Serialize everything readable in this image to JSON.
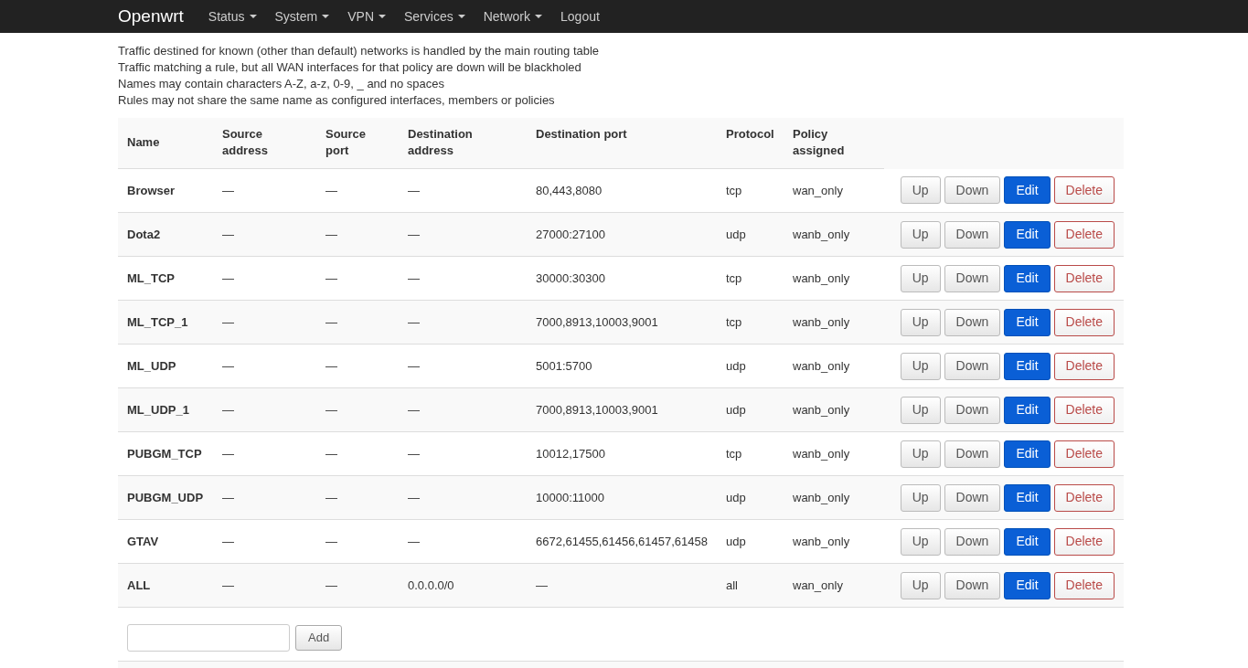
{
  "navbar": {
    "brand": "Openwrt",
    "menu": [
      {
        "label": "Status",
        "dropdown": true
      },
      {
        "label": "System",
        "dropdown": true
      },
      {
        "label": "VPN",
        "dropdown": true
      },
      {
        "label": "Services",
        "dropdown": true
      },
      {
        "label": "Network",
        "dropdown": true
      },
      {
        "label": "Logout",
        "dropdown": false
      }
    ]
  },
  "notes": [
    "Traffic destined for known (other than default) networks is handled by the main routing table",
    "Traffic matching a rule, but all WAN interfaces for that policy are down will be blackholed",
    "Names may contain characters A-Z, a-z, 0-9, _ and no spaces",
    "Rules may not share the same name as configured interfaces, members or policies"
  ],
  "table": {
    "columns": [
      "Name",
      "Source address",
      "Source port",
      "Destination address",
      "Destination port",
      "Protocol",
      "Policy assigned"
    ],
    "rows": [
      {
        "cells": [
          "Browser",
          "—",
          "—",
          "—",
          "80,443,8080",
          "tcp",
          "wan_only"
        ],
        "actions": [
          {
            "label": "Up",
            "kind": "default"
          },
          {
            "label": "Down",
            "kind": "default"
          },
          {
            "label": "Edit",
            "kind": "primary"
          },
          {
            "label": "Delete",
            "kind": "danger"
          }
        ]
      },
      {
        "cells": [
          "Dota2",
          "—",
          "—",
          "—",
          "27000:27100",
          "udp",
          "wanb_only"
        ],
        "actions": [
          {
            "label": "Up",
            "kind": "default"
          },
          {
            "label": "Down",
            "kind": "default"
          },
          {
            "label": "Edit",
            "kind": "primary"
          },
          {
            "label": "Delete",
            "kind": "danger"
          }
        ]
      },
      {
        "cells": [
          "ML_TCP",
          "—",
          "—",
          "—",
          "30000:30300",
          "tcp",
          "wanb_only"
        ],
        "actions": [
          {
            "label": "Up",
            "kind": "default"
          },
          {
            "label": "Down",
            "kind": "default"
          },
          {
            "label": "Edit",
            "kind": "primary"
          },
          {
            "label": "Delete",
            "kind": "danger"
          }
        ]
      },
      {
        "cells": [
          "ML_TCP_1",
          "—",
          "—",
          "—",
          "7000,8913,10003,9001",
          "tcp",
          "wanb_only"
        ],
        "actions": [
          {
            "label": "Up",
            "kind": "default"
          },
          {
            "label": "Down",
            "kind": "default"
          },
          {
            "label": "Edit",
            "kind": "primary"
          },
          {
            "label": "Delete",
            "kind": "danger"
          }
        ]
      },
      {
        "cells": [
          "ML_UDP",
          "—",
          "—",
          "—",
          "5001:5700",
          "udp",
          "wanb_only"
        ],
        "actions": [
          {
            "label": "Up",
            "kind": "default"
          },
          {
            "label": "Down",
            "kind": "default"
          },
          {
            "label": "Edit",
            "kind": "primary"
          },
          {
            "label": "Delete",
            "kind": "danger"
          }
        ]
      },
      {
        "cells": [
          "ML_UDP_1",
          "—",
          "—",
          "—",
          "7000,8913,10003,9001",
          "udp",
          "wanb_only"
        ],
        "actions": [
          {
            "label": "Up",
            "kind": "default"
          },
          {
            "label": "Down",
            "kind": "default"
          },
          {
            "label": "Edit",
            "kind": "primary"
          },
          {
            "label": "Delete",
            "kind": "danger"
          }
        ]
      },
      {
        "cells": [
          "PUBGM_TCP",
          "—",
          "—",
          "—",
          "10012,17500",
          "tcp",
          "wanb_only"
        ],
        "actions": [
          {
            "label": "Up",
            "kind": "default"
          },
          {
            "label": "Down",
            "kind": "default"
          },
          {
            "label": "Edit",
            "kind": "primary"
          },
          {
            "label": "Delete",
            "kind": "danger"
          }
        ]
      },
      {
        "cells": [
          "PUBGM_UDP",
          "—",
          "—",
          "—",
          "10000:11000",
          "udp",
          "wanb_only"
        ],
        "actions": [
          {
            "label": "Up",
            "kind": "default"
          },
          {
            "label": "Down",
            "kind": "default"
          },
          {
            "label": "Edit",
            "kind": "primary"
          },
          {
            "label": "Delete",
            "kind": "danger"
          }
        ]
      },
      {
        "cells": [
          "GTAV",
          "—",
          "—",
          "—",
          "6672,61455,61456,61457,61458",
          "udp",
          "wanb_only"
        ],
        "actions": [
          {
            "label": "Up",
            "kind": "default"
          },
          {
            "label": "Down",
            "kind": "default"
          },
          {
            "label": "Edit",
            "kind": "primary"
          },
          {
            "label": "Delete",
            "kind": "danger"
          }
        ]
      },
      {
        "cells": [
          "ALL",
          "—",
          "—",
          "0.0.0.0/0",
          "—",
          "all",
          "wan_only"
        ],
        "actions": [
          {
            "label": "Up",
            "kind": "default"
          },
          {
            "label": "Down",
            "kind": "default"
          },
          {
            "label": "Edit",
            "kind": "primary"
          },
          {
            "label": "Delete",
            "kind": "danger"
          }
        ]
      }
    ]
  },
  "add_form": {
    "button": "Add"
  }
}
